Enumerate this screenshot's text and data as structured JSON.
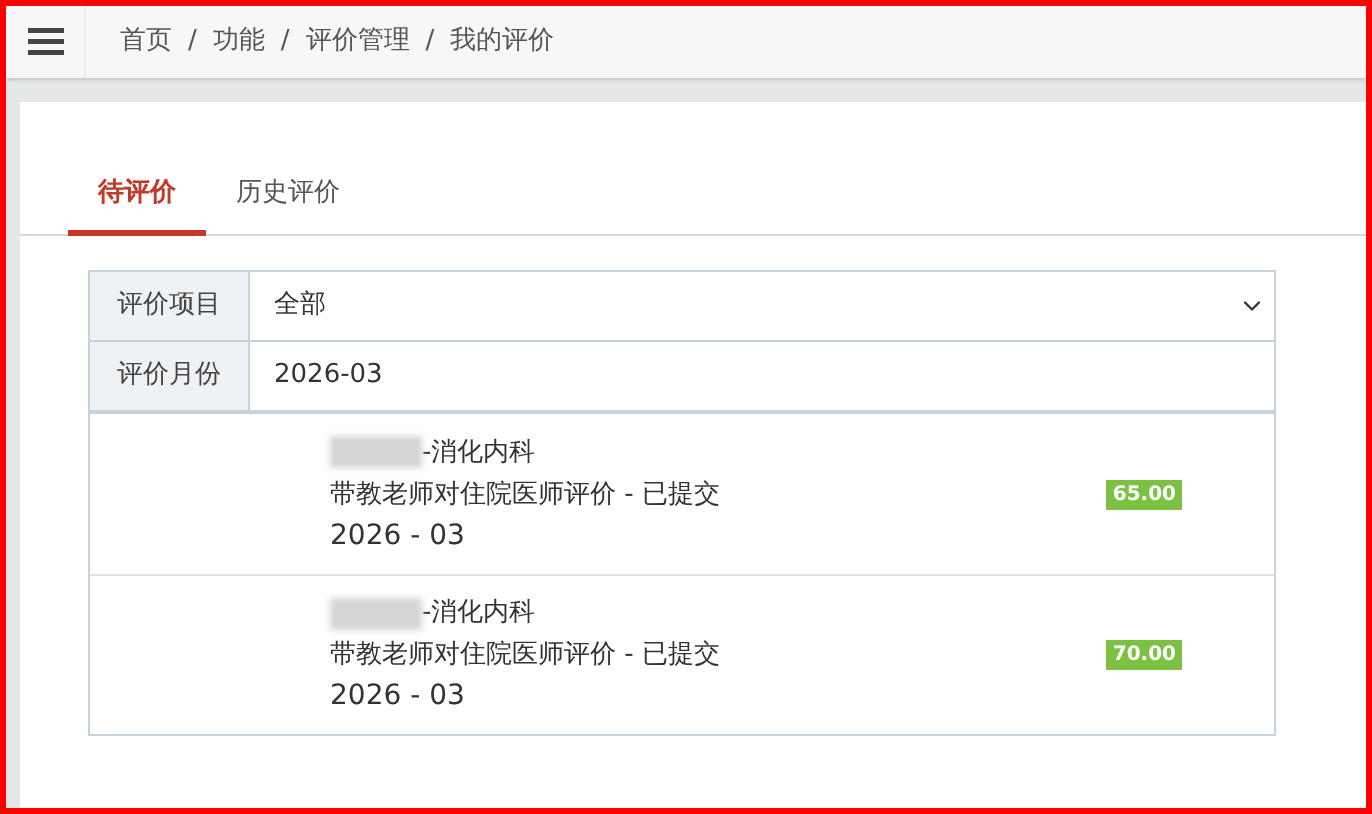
{
  "breadcrumb": {
    "items": [
      "首页",
      "功能",
      "评价管理",
      "我的评价"
    ],
    "separator": "/"
  },
  "tabs": [
    {
      "label": "待评价",
      "selected": true
    },
    {
      "label": "历史评价",
      "selected": false
    }
  ],
  "filters": [
    {
      "kind": "select",
      "label": "评价项目",
      "value": "全部"
    },
    {
      "kind": "text",
      "label": "评价月份",
      "value": "2026-03"
    }
  ],
  "evaluations": [
    {
      "department": "-消化内科",
      "title": "带教老师对住院医师评价 - 已提交",
      "month": "2026 - 03",
      "score": "65.00"
    },
    {
      "department": "-消化内科",
      "title": "带教老师对住院医师评价 - 已提交",
      "month": "2026 - 03",
      "score": "70.00"
    }
  ]
}
